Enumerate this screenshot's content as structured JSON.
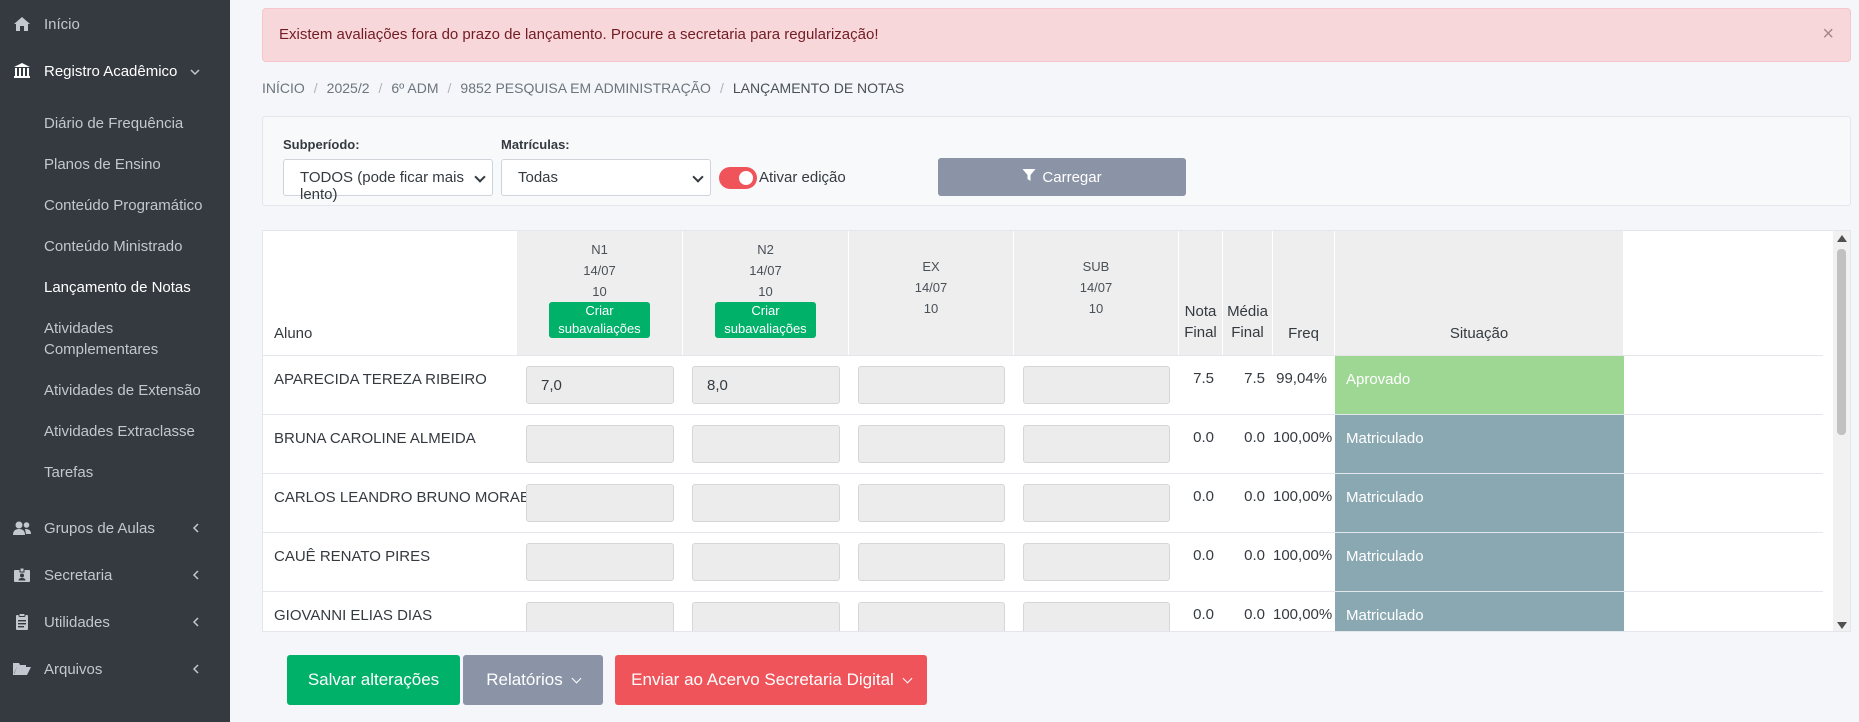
{
  "sidebar": {
    "items": [
      {
        "label": "Início",
        "icon": "home-icon"
      },
      {
        "label": "Registro Acadêmico",
        "icon": "institution-icon"
      },
      {
        "label": "Grupos de Aulas",
        "icon": "users-icon"
      },
      {
        "label": "Secretaria",
        "icon": "id-badge-icon"
      },
      {
        "label": "Utilidades",
        "icon": "clipboard-icon"
      },
      {
        "label": "Arquivos",
        "icon": "folder-open-icon"
      }
    ],
    "subitems": [
      "Diário de Frequência",
      "Planos de Ensino",
      "Conteúdo Programático",
      "Conteúdo Ministrado",
      "Lançamento de Notas",
      "Atividades Complementares",
      "Atividades de Extensão",
      "Atividades Extraclasse",
      "Tarefas"
    ]
  },
  "alert": {
    "text": "Existem avaliações fora do prazo de lançamento. Procure a secretaria para regularização!",
    "close": "×"
  },
  "breadcrumb": [
    "INÍCIO",
    "2025/2",
    "6º ADM",
    "9852 PESQUISA EM ADMINISTRAÇÃO",
    "LANÇAMENTO DE NOTAS"
  ],
  "filters": {
    "subperiodo_label": "Subperíodo:",
    "subperiodo_value": "TODOS (pode ficar mais lento)",
    "matriculas_label": "Matrículas:",
    "matriculas_value": "Todas",
    "toggle_label": "Ativar edição",
    "toggle_on": true,
    "load_button": "Carregar"
  },
  "table": {
    "headers": {
      "aluno": "Aluno",
      "nota_final_1": "Nota",
      "nota_final_2": "Final",
      "media_final_1": "Média",
      "media_final_2": "Final",
      "freq": "Freq",
      "situacao": "Situação"
    },
    "evaluations": [
      {
        "name": "N1",
        "date": "14/07",
        "weight": "10",
        "sub_button": [
          "Criar",
          "subavaliações"
        ]
      },
      {
        "name": "N2",
        "date": "14/07",
        "weight": "10",
        "sub_button": [
          "Criar",
          "subavaliações"
        ]
      },
      {
        "name": "EX",
        "date": "14/07",
        "weight": "10"
      },
      {
        "name": "SUB",
        "date": "14/07",
        "weight": "10"
      }
    ],
    "rows": [
      {
        "name": "APARECIDA TEREZA RIBEIRO",
        "n1": "7,0",
        "n2": "8,0",
        "ex": "",
        "sub": "",
        "nota_final": "7.5",
        "media_final": "7.5",
        "freq": "99,04%",
        "situacao": "Aprovado"
      },
      {
        "name": "BRUNA CAROLINE ALMEIDA",
        "n1": "",
        "n2": "",
        "ex": "",
        "sub": "",
        "nota_final": "0.0",
        "media_final": "0.0",
        "freq": "100,00%",
        "situacao": "Matriculado"
      },
      {
        "name": "CARLOS LEANDRO BRUNO MORAES",
        "n1": "",
        "n2": "",
        "ex": "",
        "sub": "",
        "nota_final": "0.0",
        "media_final": "0.0",
        "freq": "100,00%",
        "situacao": "Matriculado"
      },
      {
        "name": "CAUÊ RENATO PIRES",
        "n1": "",
        "n2": "",
        "ex": "",
        "sub": "",
        "nota_final": "0.0",
        "media_final": "0.0",
        "freq": "100,00%",
        "situacao": "Matriculado"
      },
      {
        "name": "GIOVANNI ELIAS DIAS",
        "n1": "",
        "n2": "",
        "ex": "",
        "sub": "",
        "nota_final": "0.0",
        "media_final": "0.0",
        "freq": "100,00%",
        "situacao": "Matriculado"
      }
    ]
  },
  "actions": {
    "save": "Salvar alterações",
    "reports": "Relatórios",
    "send": "Enviar ao Acervo Secretaria Digital"
  },
  "colors": {
    "sidebar_bg": "#343a40",
    "alert_bg": "#f8d7da",
    "success": "#00b16a",
    "danger": "#f0545b",
    "secondary": "#8a94a6",
    "approved": "#9ed694",
    "enrolled": "#8aa8b1"
  }
}
